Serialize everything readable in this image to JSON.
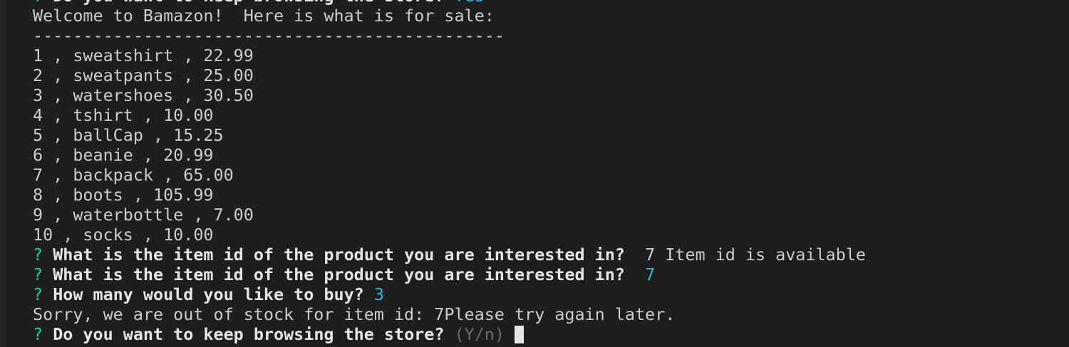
{
  "terminal": {
    "prev_prompt": {
      "mark": "?",
      "question": "Do you want to keep browsing the store?",
      "answer": "Yes"
    },
    "welcome": "Welcome to Bamazon!  Here is what is for sale:",
    "separator": "-----------------------------------------------",
    "products": [
      {
        "line": "1 , sweatshirt , 22.99"
      },
      {
        "line": "2 , sweatpants , 25.00"
      },
      {
        "line": "3 , watershoes , 30.50"
      },
      {
        "line": "4 , tshirt , 10.00"
      },
      {
        "line": "5 , ballCap , 15.25"
      },
      {
        "line": "6 , beanie , 20.99"
      },
      {
        "line": "7 , backpack , 65.00"
      },
      {
        "line": "8 , boots , 105.99"
      },
      {
        "line": "9 , waterbottle , 7.00"
      },
      {
        "line": "10 , socks , 10.00"
      }
    ],
    "prompt1": {
      "mark": "?",
      "question": "What is the item id of the product you are interested in?",
      "trail": "  7 Item id is available"
    },
    "prompt2": {
      "mark": "?",
      "question": "What is the item id of the product you are interested in?",
      "answer": "7"
    },
    "prompt3": {
      "mark": "?",
      "question": "How many would you like to buy?",
      "answer": "3"
    },
    "message": "Sorry, we are out of stock for item id: 7Please try again later.",
    "prompt4": {
      "mark": "?",
      "question": "Do you want to keep browsing the store?",
      "hint": "(Y/n)"
    }
  },
  "colors": {
    "background": "#1e1e1e",
    "text": "#cccccc",
    "prompt_mark": "#23d18b",
    "answer": "#29b8db",
    "hint": "#6b6b6b"
  }
}
